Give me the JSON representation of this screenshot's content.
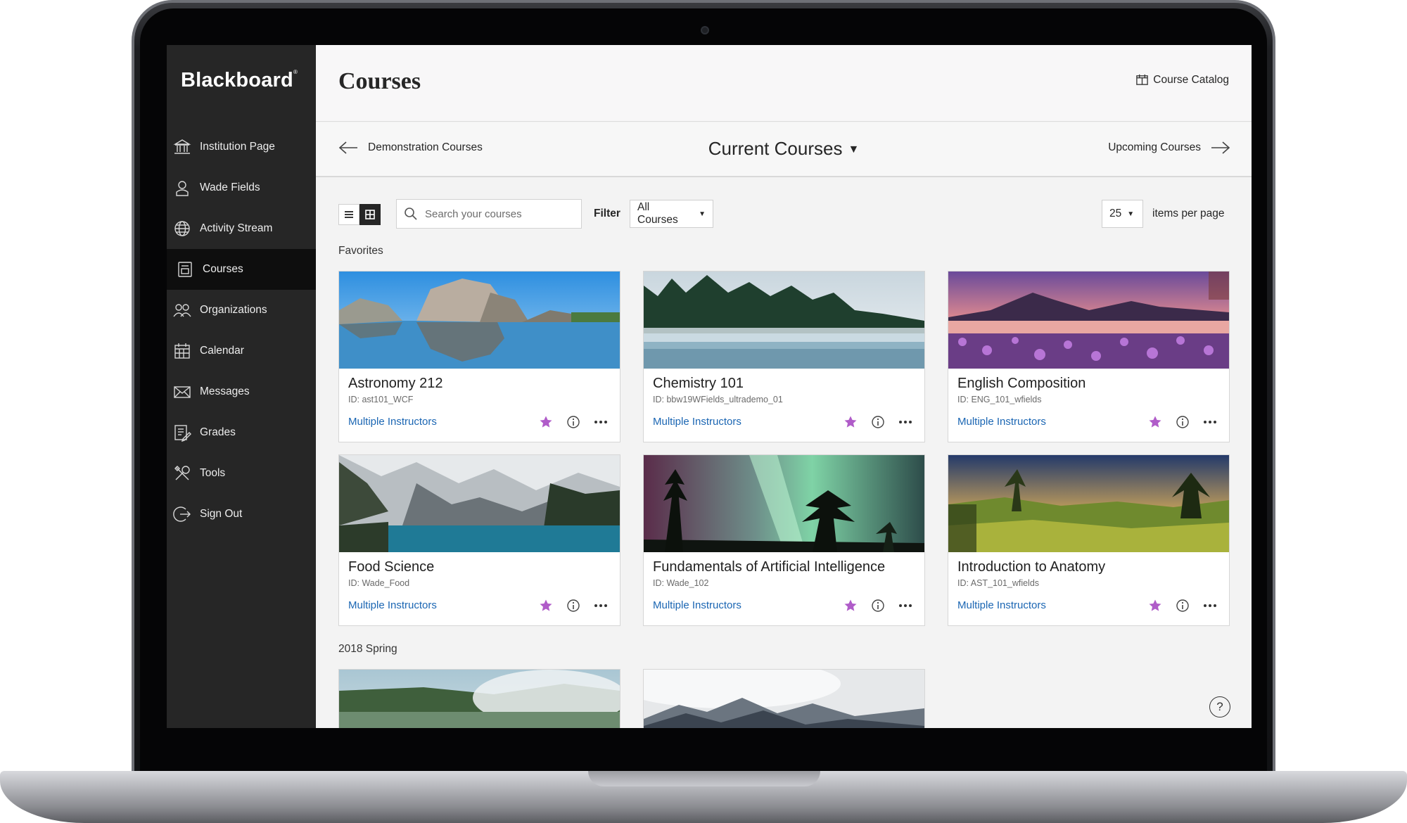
{
  "app": {
    "brand": "Blackboard"
  },
  "sidebar": {
    "items": [
      {
        "label": "Institution Page",
        "icon": "institution-icon"
      },
      {
        "label": "Wade Fields",
        "icon": "user-icon"
      },
      {
        "label": "Activity Stream",
        "icon": "globe-icon"
      },
      {
        "label": "Courses",
        "icon": "courses-icon",
        "active": true
      },
      {
        "label": "Organizations",
        "icon": "organizations-icon"
      },
      {
        "label": "Calendar",
        "icon": "calendar-icon"
      },
      {
        "label": "Messages",
        "icon": "envelope-icon"
      },
      {
        "label": "Grades",
        "icon": "grades-icon"
      },
      {
        "label": "Tools",
        "icon": "tools-icon"
      },
      {
        "label": "Sign Out",
        "icon": "sign-out-icon"
      }
    ]
  },
  "header": {
    "title": "Courses",
    "catalog_label": "Course Catalog"
  },
  "terms": {
    "previous": "Demonstration Courses",
    "current": "Current Courses",
    "next": "Upcoming Courses"
  },
  "controls": {
    "search_placeholder": "Search your courses",
    "filter_label": "Filter",
    "filter_value": "All Courses",
    "per_page_value": "25",
    "per_page_label": "items per page"
  },
  "sections": {
    "favorites": "Favorites",
    "spring": "2018 Spring"
  },
  "favorites": [
    {
      "title": "Astronomy 212",
      "id": "ID: ast101_WCF",
      "instructors": "Multiple Instructors"
    },
    {
      "title": "Chemistry 101",
      "id": "ID: bbw19WFields_ultrademo_01",
      "instructors": "Multiple Instructors"
    },
    {
      "title": "English Composition",
      "id": "ID: ENG_101_wfields",
      "instructors": "Multiple Instructors"
    },
    {
      "title": "Food Science",
      "id": "ID: Wade_Food",
      "instructors": "Multiple Instructors"
    },
    {
      "title": "Fundamentals of Artificial Intelligence",
      "id": "ID: Wade_102",
      "instructors": "Multiple Instructors"
    },
    {
      "title": "Introduction to Anatomy",
      "id": "ID: AST_101_wfields",
      "instructors": "Multiple Instructors"
    }
  ],
  "colors": {
    "sidebar_bg": "#262626",
    "active_bg": "#0e0e0e",
    "link": "#1b66b3",
    "favorite_star": "#b05cc9"
  },
  "help_label": "?"
}
